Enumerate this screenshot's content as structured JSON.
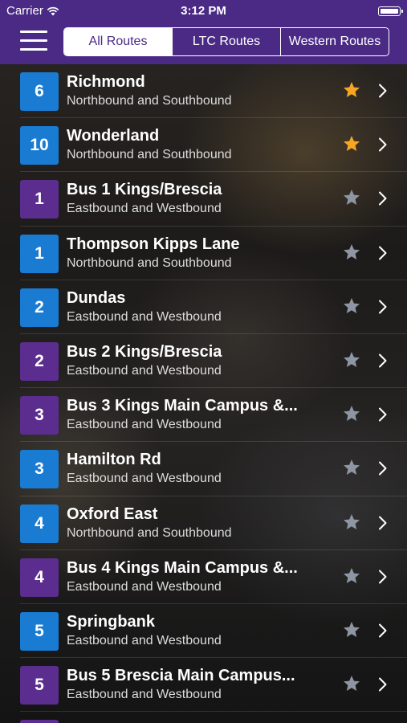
{
  "status_bar": {
    "carrier": "Carrier",
    "time": "3:12 PM"
  },
  "tabs": [
    {
      "label": "All Routes",
      "active": true
    },
    {
      "label": "LTC Routes",
      "active": false
    },
    {
      "label": "Western Routes",
      "active": false
    }
  ],
  "colors": {
    "header": "#4b2a86",
    "ltc_badge": "#1a7bd2",
    "western_badge": "#5b2d8e",
    "favorite_star": "#f5a623",
    "default_star": "#8e95a3"
  },
  "routes": [
    {
      "number": "6",
      "title": "Richmond",
      "subtitle": "Northbound and Southbound",
      "badge_color": "#1a7bd2",
      "favorite": true
    },
    {
      "number": "10",
      "title": "Wonderland",
      "subtitle": "Northbound and Southbound",
      "badge_color": "#1a7bd2",
      "favorite": true
    },
    {
      "number": "1",
      "title": "Bus 1 Kings/Brescia",
      "subtitle": "Eastbound and Westbound",
      "badge_color": "#5b2d8e",
      "favorite": false
    },
    {
      "number": "1",
      "title": "Thompson Kipps Lane",
      "subtitle": "Northbound and Southbound",
      "badge_color": "#1a7bd2",
      "favorite": false
    },
    {
      "number": "2",
      "title": "Dundas",
      "subtitle": "Eastbound and Westbound",
      "badge_color": "#1a7bd2",
      "favorite": false
    },
    {
      "number": "2",
      "title": "Bus 2 Kings/Brescia",
      "subtitle": "Eastbound and Westbound",
      "badge_color": "#5b2d8e",
      "favorite": false
    },
    {
      "number": "3",
      "title": "Bus 3 Kings Main Campus &...",
      "subtitle": "Eastbound and Westbound",
      "badge_color": "#5b2d8e",
      "favorite": false
    },
    {
      "number": "3",
      "title": "Hamilton Rd",
      "subtitle": "Eastbound and Westbound",
      "badge_color": "#1a7bd2",
      "favorite": false
    },
    {
      "number": "4",
      "title": "Oxford East",
      "subtitle": "Northbound and Southbound",
      "badge_color": "#1a7bd2",
      "favorite": false
    },
    {
      "number": "4",
      "title": "Bus 4 Kings Main Campus &...",
      "subtitle": "Eastbound and Westbound",
      "badge_color": "#5b2d8e",
      "favorite": false
    },
    {
      "number": "5",
      "title": "Springbank",
      "subtitle": "Eastbound and Westbound",
      "badge_color": "#1a7bd2",
      "favorite": false
    },
    {
      "number": "5",
      "title": "Bus 5 Brescia Main Campus...",
      "subtitle": "Eastbound and Westbound",
      "badge_color": "#5b2d8e",
      "favorite": false
    }
  ],
  "partial_row": {
    "badge_color": "#5b2d8e"
  }
}
